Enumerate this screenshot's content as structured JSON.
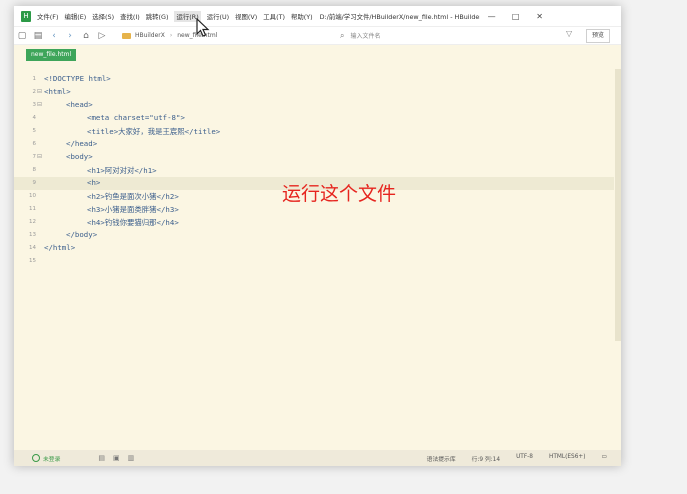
{
  "app": {
    "logo": "H",
    "title": "D:/前端/学习文件/HBuilderX/new_file.html - HBuilder ..."
  },
  "menu": [
    "文件(F)",
    "编辑(E)",
    "选择(S)",
    "查找(I)",
    "跳转(G)",
    "运行(R)",
    "运行(U)",
    "视图(V)",
    "工具(T)",
    "帮助(Y)"
  ],
  "window_controls": {
    "minimize": "—",
    "maximize": "□",
    "close": "✕"
  },
  "breadcrumb": {
    "project": "HBuilderX",
    "file": "new_file.html"
  },
  "search": {
    "placeholder": "输入文件名"
  },
  "toolbar": {
    "preview_label": "预览"
  },
  "tab": {
    "label": "new_file.html"
  },
  "code_lines": [
    {
      "num": "1",
      "text": "<!DOCTYPE html>"
    },
    {
      "num": "2",
      "text": "<html>"
    },
    {
      "num": "3",
      "text": "<head>"
    },
    {
      "num": "4",
      "text": "<meta charset=\"utf-8\">"
    },
    {
      "num": "5",
      "text": "<title>大家好，我是王宸熙</title>"
    },
    {
      "num": "6",
      "text": "</head>"
    },
    {
      "num": "7",
      "text": "<body>"
    },
    {
      "num": "8",
      "text": "<h1>阿对对对</h1>"
    },
    {
      "num": "9",
      "text": "<h>"
    },
    {
      "num": "10",
      "text": "<h2>钓鱼是面次小猪</h2>"
    },
    {
      "num": "11",
      "text": "<h3>小猪是面类胖猪</h3>"
    },
    {
      "num": "12",
      "text": "<h4>钓钱你要猫归那</h4>"
    },
    {
      "num": "13",
      "text": "</body>"
    },
    {
      "num": "14",
      "text": "</html>"
    },
    {
      "num": "15",
      "text": ""
    }
  ],
  "annotation": "运行这个文件",
  "status": {
    "login": "未登录",
    "position": "行:9  列:14",
    "encoding": "UTF-8",
    "language": "HTML(ES6+)",
    "syntax": "语法提示库"
  },
  "colors": {
    "accent": "#3ea55a",
    "annotation": "#e6251f",
    "editor_bg": "#fbf6e3"
  }
}
